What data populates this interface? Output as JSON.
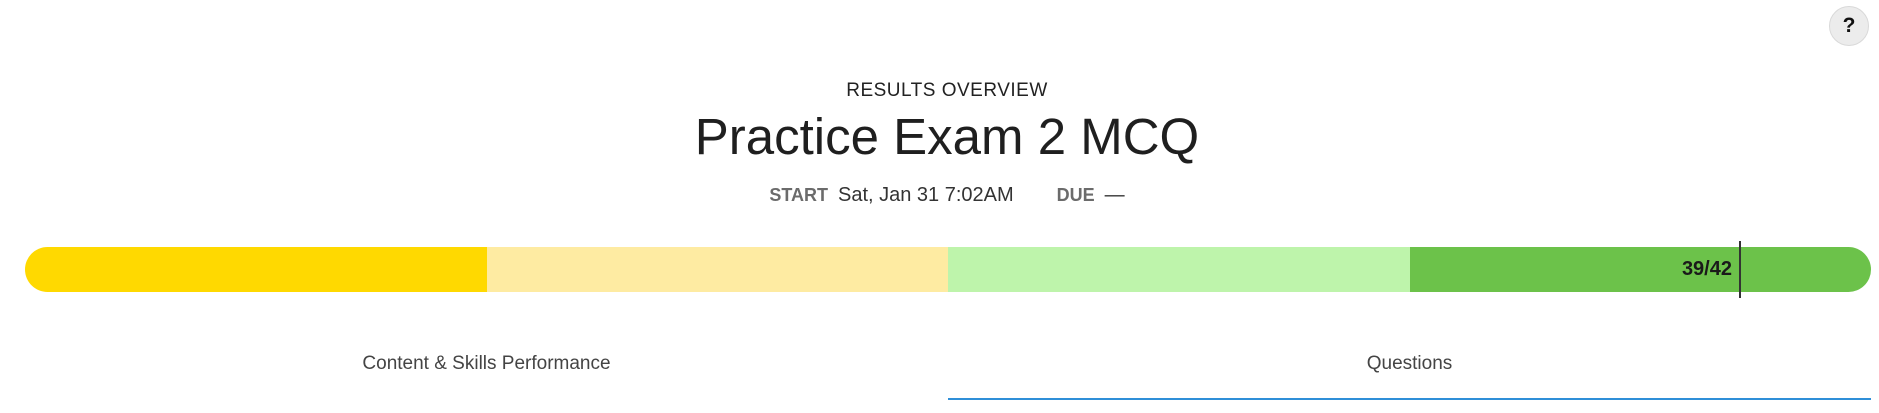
{
  "help": {
    "label": "?"
  },
  "header": {
    "overline": "RESULTS OVERVIEW",
    "title": "Practice Exam 2 MCQ"
  },
  "dates": {
    "start_label": "START",
    "start_value": "Sat, Jan 31 7:02AM",
    "due_label": "DUE",
    "due_value": "—"
  },
  "score": {
    "correct": 39,
    "total": 42,
    "label": "39/42",
    "band_colors": [
      "#ffd900",
      "#feeba2",
      "#bef4ab",
      "#6cc24a"
    ],
    "marker_color": "#333333"
  },
  "tabs": [
    {
      "label": "Content & Skills Performance",
      "active": false
    },
    {
      "label": "Questions",
      "active": true
    }
  ],
  "colors": {
    "tab_active_underline": "#2f8fd8"
  }
}
